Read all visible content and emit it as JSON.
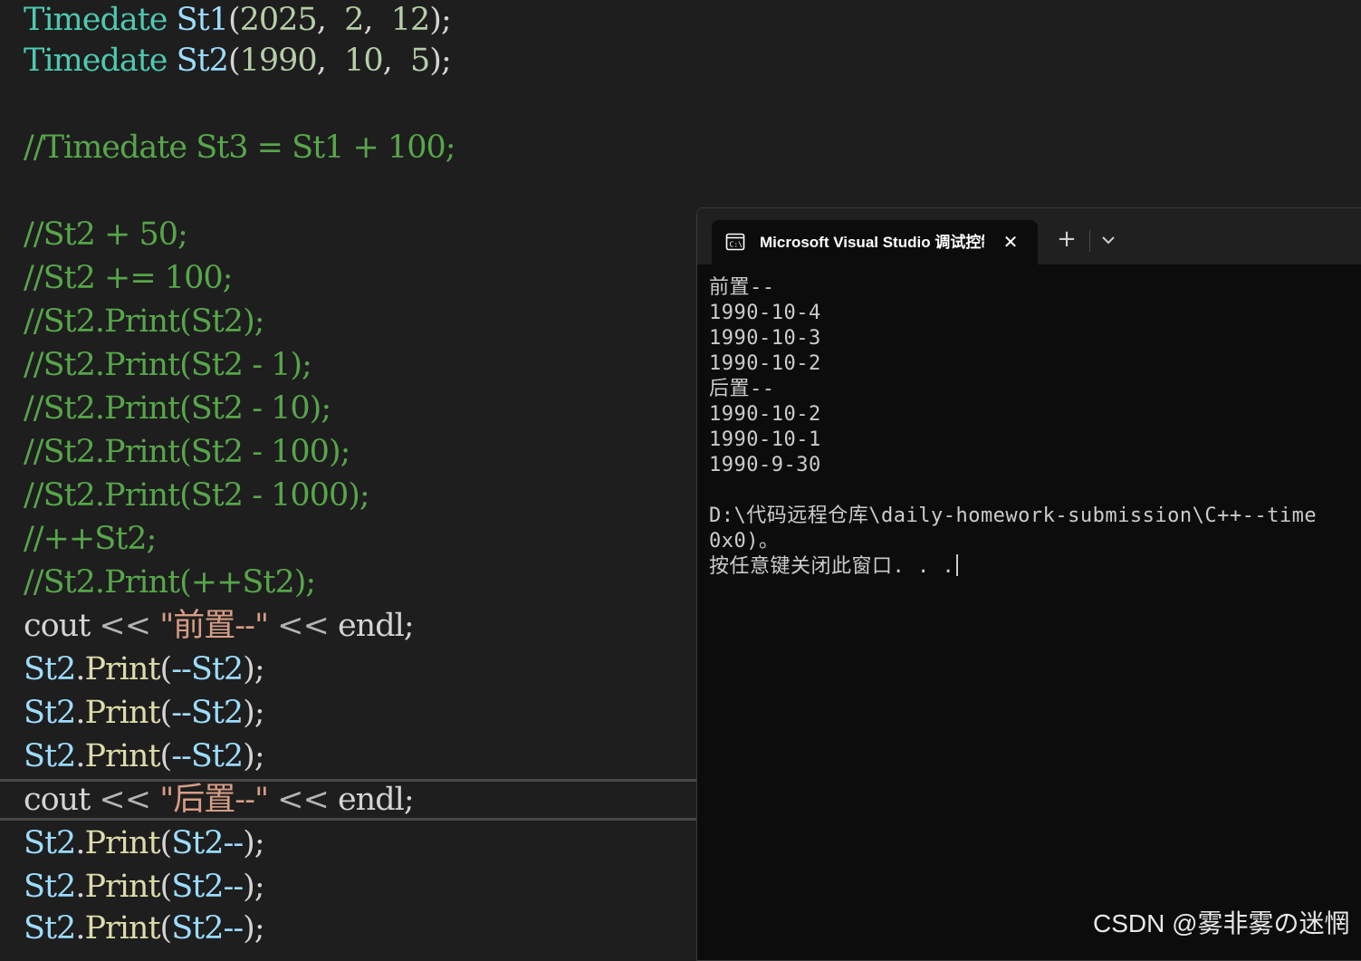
{
  "editor": {
    "lines": {
      "l1": [
        "Timedate",
        " ",
        "St1",
        "(",
        "2025",
        ",  ",
        "2",
        ",  ",
        "12",
        ");"
      ],
      "l2": [
        "Timedate",
        " ",
        "St2",
        "(",
        "1990",
        ",  ",
        "10",
        ",  ",
        "5",
        ");"
      ],
      "l3": "//Timedate St3 = St1 + 100;",
      "l4": "//St2 + 50;",
      "l5": "//St2 += 100;",
      "l6": "//St2.Print(St2);",
      "l7": "//St2.Print(St2 - 1);",
      "l8": "//St2.Print(St2 - 10);",
      "l9": "//St2.Print(St2 - 100);",
      "l10": "//St2.Print(St2 - 1000);",
      "l11": "//++St2;",
      "l12": "//St2.Print(++St2);",
      "l13": [
        "cout",
        " << ",
        "\"前置--\"",
        " << ",
        "endl",
        ";"
      ],
      "l14": [
        "St2",
        ".",
        "Print",
        "(",
        "--St2",
        ");"
      ],
      "l15": [
        "St2",
        ".",
        "Print",
        "(",
        "--St2",
        ");"
      ],
      "l16": [
        "St2",
        ".",
        "Print",
        "(",
        "--St2",
        ");"
      ],
      "l17": [
        "cout",
        " << ",
        "\"后置--\"",
        " << ",
        "endl",
        ";"
      ],
      "l18": [
        "St2",
        ".",
        "Print",
        "(",
        "St2--",
        ");"
      ],
      "l19": [
        "St2",
        ".",
        "Print",
        "(",
        "St2--",
        ");"
      ],
      "l20": [
        "St2",
        ".",
        "Print",
        "(",
        "St2--",
        ");"
      ]
    }
  },
  "terminal": {
    "tab_title": "Microsoft Visual Studio 调试控制台",
    "close_glyph": "✕",
    "new_tab_glyph": "+",
    "output": [
      "前置--",
      "1990-10-4",
      "1990-10-3",
      "1990-10-2",
      "后置--",
      "1990-10-2",
      "1990-10-1",
      "1990-9-30",
      "",
      "D:\\代码远程仓库\\daily-homework-submission\\C++--time",
      "0x0)。",
      "按任意键关闭此窗口. . ."
    ]
  },
  "watermark": "CSDN @雾非雾の迷惘",
  "colors": {
    "editor_bg": "#1e1e1e",
    "type": "#4ec9b0",
    "variable": "#9cdcfe",
    "function": "#dcdcaa",
    "number": "#b5cea8",
    "string": "#d69d85",
    "comment": "#57a64a",
    "terminal_bg": "#0c0c0c",
    "terminal_text": "#cccccc"
  },
  "icons": {
    "tab_icon": "console-icon",
    "dropdown": "chevron-down-icon"
  }
}
